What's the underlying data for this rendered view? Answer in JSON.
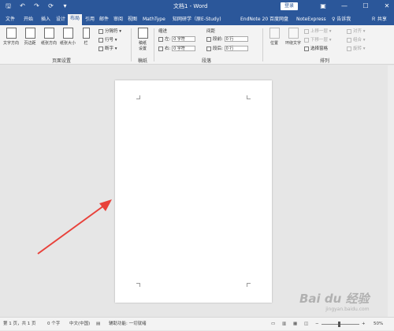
{
  "title_bar": {
    "doc_title": "文档1 - Word",
    "login_label": "登录",
    "qat_icons": [
      "save-icon",
      "undo-icon",
      "redo-icon",
      "repeat-icon",
      "customize-icon"
    ],
    "win_icons": [
      "restore-ribbon-icon",
      "minimize-icon",
      "maximize-icon",
      "close-icon"
    ],
    "win_glyphs": [
      "▣",
      "—",
      "☐",
      "✕"
    ],
    "qat_glyphs": [
      "🖫",
      "↶",
      "↷",
      "⟳",
      "▾"
    ]
  },
  "tabs": [
    {
      "label": "文件"
    },
    {
      "label": "开始"
    },
    {
      "label": "插入"
    },
    {
      "label": "设计"
    },
    {
      "label": "布局",
      "active": true
    },
    {
      "label": "引用"
    },
    {
      "label": "邮件"
    },
    {
      "label": "审阅"
    },
    {
      "label": "视图"
    },
    {
      "label": "MathType"
    },
    {
      "label": "知网研学（原E-Study)"
    },
    {
      "label": "EndNote 20"
    },
    {
      "label": "百度网盘"
    },
    {
      "label": "NoteExpress"
    }
  ],
  "tell_me": "♀ 告诉我",
  "share": "Ｒ 共享",
  "ribbon": {
    "page_setup": {
      "group_label": "页面设置",
      "buttons": [
        "文字方向",
        "页边距",
        "纸张方向",
        "纸张大小",
        "栏"
      ],
      "small": [
        "分隔符 ▾",
        "行号 ▾",
        "断字 ▾"
      ]
    },
    "manuscript": {
      "group_label": "稿纸",
      "button": "稿纸设置"
    },
    "paragraph": {
      "group_label": "段落",
      "indent_head": "缩进",
      "spacing_head": "间距",
      "left_label": "左:",
      "right_label": "右:",
      "before_label": "段前:",
      "after_label": "段后:",
      "left_value": "0 字符",
      "right_value": "0 字符",
      "before_value": "0 行",
      "after_value": "0 行"
    },
    "arrange": {
      "group_label": "排列",
      "buttons": [
        "位置",
        "环绕文字"
      ],
      "small": [
        "上移一层 ▾",
        "下移一层 ▾",
        "选择窗格"
      ],
      "right": [
        "对齐 ▾",
        "组合 ▾",
        "旋转 ▾"
      ]
    }
  },
  "status_bar": {
    "page": "第 1 页，共 1 页",
    "words": "0 个字",
    "lang": "中文(中国)",
    "accessibility": "辅助功能: 一切就绪",
    "zoom_percent": "50%",
    "zoom_minus": "−",
    "zoom_plus": "+"
  },
  "watermark": {
    "text": "Bai du 经验",
    "sub": "jingyan.baidu.com"
  },
  "colors": {
    "brand": "#2b579a",
    "arrow": "#e8413a"
  },
  "zoom_level": 0.5
}
